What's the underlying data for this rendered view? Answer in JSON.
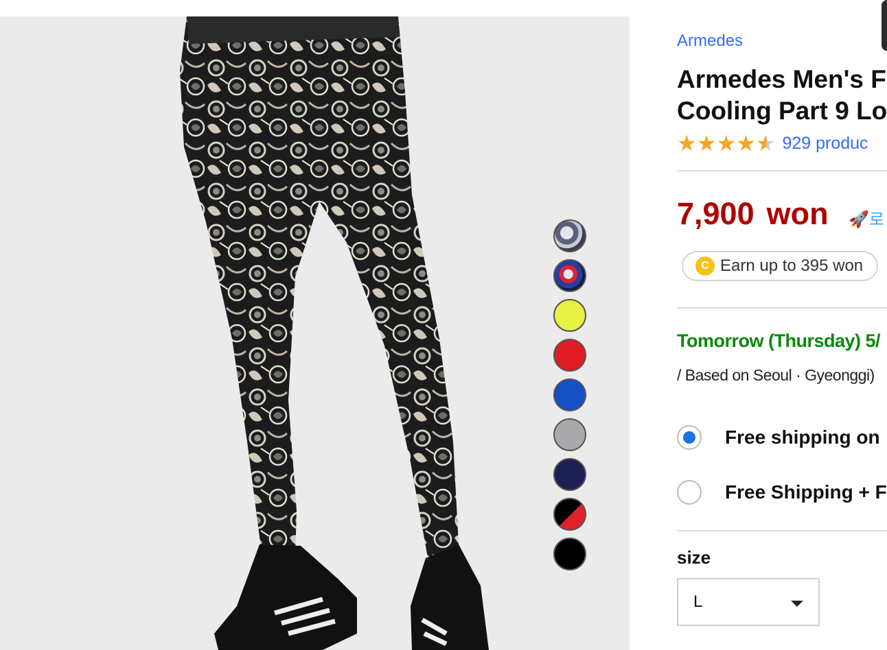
{
  "product": {
    "brand": "Armedes",
    "title_line1": "Armedes Men's F",
    "title_line2": "Cooling Part 9 Lo",
    "rating_count": "929 produc",
    "rating_value": 4.5,
    "price_number": "7,900",
    "price_unit": "won",
    "rocket_badge": "🚀로",
    "cashback_coin": "C",
    "cashback": "Earn up to 395 won"
  },
  "delivery": {
    "arrival": "Tomorrow (Thursday) 5/",
    "region": "/ Based on Seoul · Gyeonggi)"
  },
  "shipping_options": [
    {
      "label": "Free shipping on",
      "selected": true
    },
    {
      "label": "Free Shipping + F",
      "selected": false
    }
  ],
  "size": {
    "label": "size",
    "selected": "L"
  },
  "swatches": [
    {
      "name": "black-gray-pattern",
      "color": "#9aa0b0"
    },
    {
      "name": "blue-red-pattern",
      "color": "#3b3f9a"
    },
    {
      "name": "neon-yellow",
      "color": "#e8f245"
    },
    {
      "name": "red",
      "color": "#e01b22"
    },
    {
      "name": "blue",
      "color": "#1450c4"
    },
    {
      "name": "gray",
      "color": "#a9a9ad"
    },
    {
      "name": "navy",
      "color": "#1b1f52"
    },
    {
      "name": "black-red",
      "color": "#e0202c"
    },
    {
      "name": "black",
      "color": "#000000"
    }
  ],
  "colors": {
    "brand_link": "#346aff",
    "price": "#ae0000",
    "delivery": "#0a8a0a",
    "star": "#f5a623",
    "radio_selected": "#1a73e8"
  }
}
